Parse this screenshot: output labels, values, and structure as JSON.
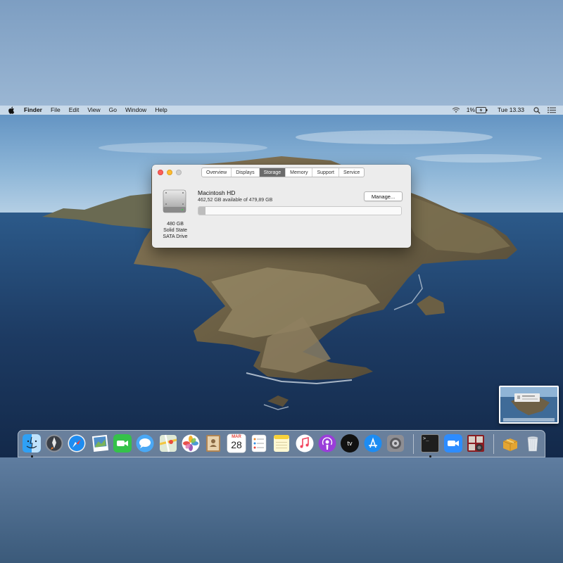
{
  "menubar": {
    "app_name": "Finder",
    "items": [
      "File",
      "Edit",
      "View",
      "Go",
      "Window",
      "Help"
    ],
    "battery_text": "1%",
    "clock": "Tue 13.33",
    "icons": [
      "apple-icon",
      "wifi-icon",
      "battery-icon",
      "spotlight-icon",
      "notification-center-icon"
    ]
  },
  "window": {
    "tabs": [
      "Overview",
      "Displays",
      "Storage",
      "Memory",
      "Support",
      "Service"
    ],
    "active_tab": "Storage",
    "disk": {
      "icon": "hard-drive-icon",
      "size": "480 GB",
      "type_line1": "Solid State",
      "type_line2": "SATA Drive"
    },
    "volume": {
      "name": "Macintosh HD",
      "available_text": "462,52 GB available of 479,89 GB",
      "used_fraction": 0.036
    },
    "manage_label": "Manage..."
  },
  "dock": {
    "apps": [
      "finder-icon",
      "launchpad-icon",
      "safari-icon",
      "preview-icon",
      "facetime-icon",
      "messages-icon",
      "maps-icon",
      "photos-icon",
      "contacts-icon",
      "calendar-icon",
      "reminders-icon",
      "notes-icon",
      "music-icon",
      "podcasts-icon",
      "tv-icon",
      "app-store-icon",
      "system-preferences-icon",
      "terminal-icon",
      "zoom-icon",
      "photo-booth-icon",
      "archive-utility-icon",
      "trash-icon"
    ],
    "calendar_month": "MAR",
    "calendar_day": "28",
    "tv_label": "tv",
    "terminal_prompt": ">_"
  },
  "colors": {
    "menubar_bg": "#d6e2ee",
    "tab_active": "#6b6b6b",
    "close": "#fc5f57",
    "minimize": "#fdbc2e",
    "zoom_disabled": "#cfcfcf",
    "sea": "#1d3b63"
  }
}
